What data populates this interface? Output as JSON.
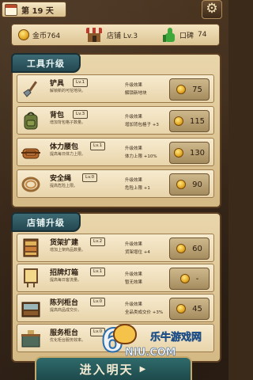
{
  "header": {
    "day_label": "第 19 天"
  },
  "stats": {
    "gold": "金币764",
    "shop": "店铺 Lv.3",
    "reputation_label": "口碑",
    "reputation_value": "74"
  },
  "tools_section": {
    "title": "工具升级",
    "items": [
      {
        "name": "铲具",
        "level": "Lv.1",
        "desc_line1": "解锁新的可挖地块。",
        "effect_title": "升级效果",
        "effect_value": "解锁新地块",
        "price": "75"
      },
      {
        "name": "背包",
        "level": "Lv.3",
        "desc_line1": "增加背包格子数量。",
        "effect_title": "升级效果",
        "effect_value": "增加背包格子 +3",
        "price": "115"
      },
      {
        "name": "体力腰包",
        "level": "Lv.1",
        "desc_line1": "提高每日体力上限。",
        "effect_title": "升级效果",
        "effect_value": "体力上限 +10%",
        "price": "130"
      },
      {
        "name": "安全绳",
        "level": "Lv.0",
        "desc_line1": "提高危险上限。",
        "effect_title": "升级效果",
        "effect_value": "危险上限 +1",
        "price": "90"
      }
    ]
  },
  "shop_section": {
    "title": "店铺升级",
    "items": [
      {
        "name": "货架扩建",
        "level": "Lv.2",
        "desc_line1": "增加上架商品数量。",
        "effect_title": "升级效果",
        "effect_value": "货架增位 +4",
        "price": "60"
      },
      {
        "name": "招牌灯箱",
        "level": "Lv.1",
        "desc_line1": "提高每日客流量。",
        "effect_title": "升级效果",
        "effect_value": "暂无效果",
        "price": "-"
      },
      {
        "name": "陈列柜台",
        "level": "Lv.0",
        "desc_line1": "提高商品成交价。",
        "effect_title": "升级效果",
        "effect_value": "全品类成交价 +3%",
        "price": "45"
      },
      {
        "name": "服务柜台",
        "level": "Lv.0",
        "desc_line1": "优化柜台服务效率。",
        "effect_title": "",
        "effect_value": "",
        "price": ""
      }
    ]
  },
  "footer": {
    "next_day_label": "进入明天"
  },
  "watermark": {
    "digit": "6",
    "brand": "乐牛游戏网",
    "sub": "NIU.COM"
  },
  "colors": {
    "panel_tab": "#2f5d66",
    "panel": "#dcc493",
    "button": "#1e4a4c"
  }
}
